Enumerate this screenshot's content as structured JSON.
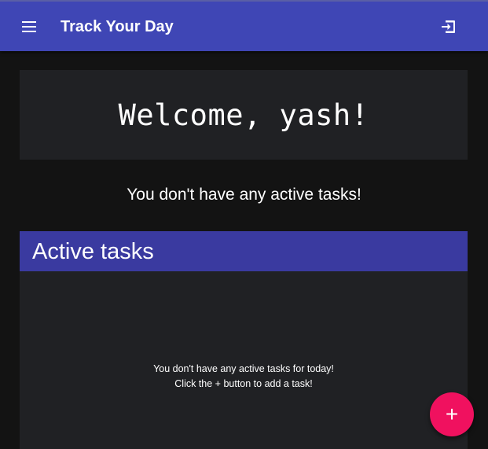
{
  "app": {
    "title": "Track Your Day",
    "brand_color": "#3f46b5",
    "menu_icon": "menu-icon",
    "logout_icon": "logout-icon"
  },
  "welcome": {
    "text": "Welcome, yash!"
  },
  "status": {
    "no_active_tasks": "You don't have any active tasks!"
  },
  "active_tasks": {
    "title": "Active tasks",
    "header_color": "#3a3aa0",
    "empty_line1": "You don't have any active tasks for today!",
    "empty_line2": "Click the + button to add a task!"
  },
  "fab": {
    "label": "+",
    "color": "#f0115f",
    "icon": "plus-icon"
  }
}
